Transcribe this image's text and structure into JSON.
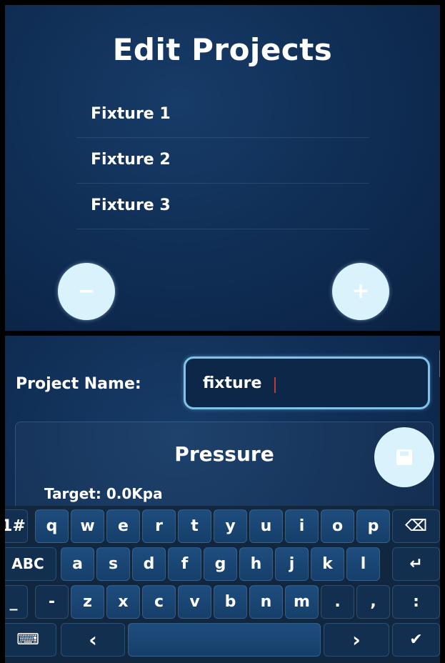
{
  "edit_projects": {
    "title": "Edit Projects",
    "projects": [
      {
        "label": "Fixture 1"
      },
      {
        "label": "Fixture 2"
      },
      {
        "label": "Fixture 3"
      }
    ],
    "remove_button": "−",
    "add_button": "+"
  },
  "project_form": {
    "name_label": "Project Name:",
    "name_value": "fixture",
    "section_title": "Pressure",
    "target_text": "Target: 0.0Kpa"
  },
  "keyboard": {
    "row1": [
      "1#",
      "q",
      "w",
      "e",
      "r",
      "t",
      "y",
      "u",
      "i",
      "o",
      "p",
      "⌫"
    ],
    "row2": [
      "ABC",
      "a",
      "s",
      "d",
      "f",
      "g",
      "h",
      "j",
      "k",
      "l",
      "↵"
    ],
    "row3": [
      "_",
      "-",
      "z",
      "x",
      "c",
      "v",
      "b",
      "n",
      "m",
      ".",
      ",",
      ":"
    ],
    "row4": [
      "⌨",
      "‹",
      "",
      "›",
      "✔"
    ]
  },
  "colors": {
    "panel_bg": "#0f2c52",
    "accent": "#7fc2ea",
    "button_fill": "#d9f2fb",
    "caret": "#c23b3b"
  },
  "icons": [
    "minus-icon",
    "plus-icon",
    "save-icon",
    "backspace-icon",
    "enter-icon",
    "keyboard-icon",
    "arrow-left-icon",
    "arrow-right-icon",
    "checkmark-icon"
  ]
}
